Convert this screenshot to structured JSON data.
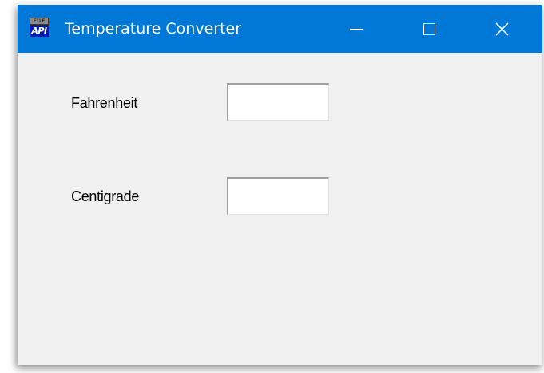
{
  "window": {
    "title": "Temperature Converter",
    "icon": {
      "name": "api-app-icon",
      "top_text": "FILE",
      "bottom_text": "API"
    },
    "controls": {
      "minimize_icon": "minimize-icon",
      "maximize_icon": "maximize-icon",
      "close_icon": "close-icon",
      "close_glyph": "✕"
    },
    "titlebar_color": "#0078d7"
  },
  "form": {
    "fahrenheit_label": "Fahrenheit",
    "fahrenheit_value": "",
    "centigrade_label": "Centigrade",
    "centigrade_value": ""
  }
}
